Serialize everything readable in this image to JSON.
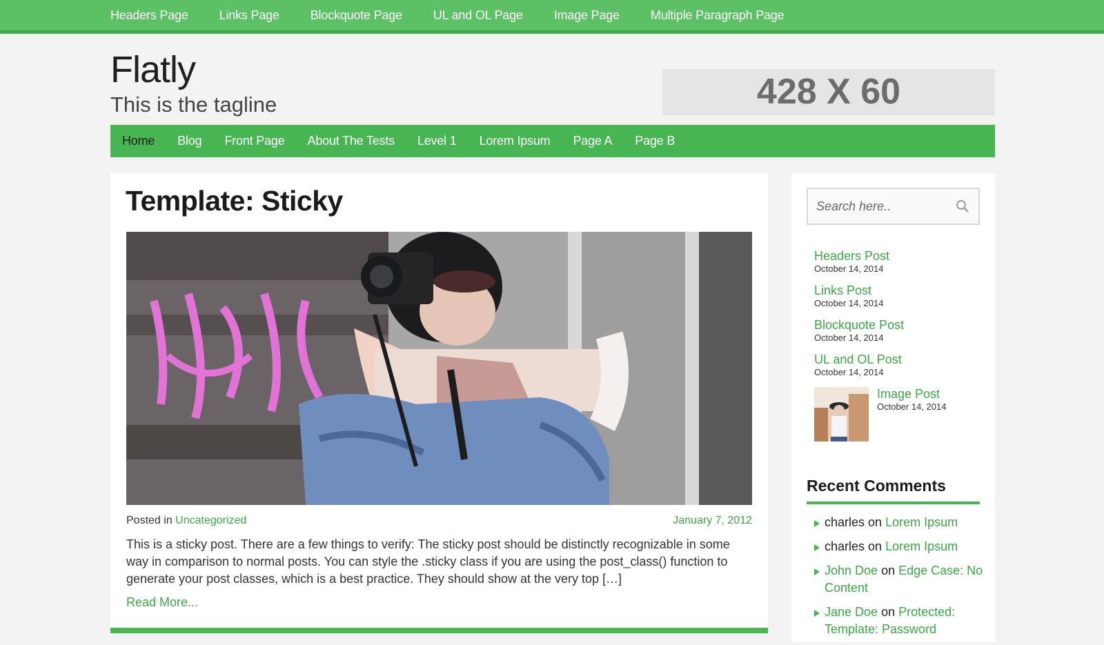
{
  "top_nav": [
    "Headers Page",
    "Links Page",
    "Blockquote Page",
    "UL and OL Page",
    "Image Page",
    "Multiple Paragraph Page"
  ],
  "site": {
    "title": "Flatly",
    "tagline": "This is the tagline",
    "ad_label": "428 X 60"
  },
  "main_nav": [
    "Home",
    "Blog",
    "Front Page",
    "About The Tests",
    "Level 1",
    "Lorem Ipsum",
    "Page A",
    "Page B"
  ],
  "post": {
    "title": "Template: Sticky",
    "posted_in_label": "Posted in",
    "category": "Uncategorized",
    "date": "January 7, 2012",
    "excerpt": "This is a sticky post. There are a few things to verify: The sticky post should be distinctly recognizable in some way in comparison to normal posts. You can style the .sticky class if you are using the post_class() function to generate your post classes, which is a best practice. They should show at the very top […]",
    "read_more": "Read More..."
  },
  "sidebar": {
    "search_placeholder": "Search here..",
    "recent_posts": [
      {
        "title": "Headers Post",
        "date": "October 14, 2014"
      },
      {
        "title": "Links Post",
        "date": "October 14, 2014"
      },
      {
        "title": "Blockquote Post",
        "date": "October 14, 2014"
      },
      {
        "title": "UL and OL Post",
        "date": "October 14, 2014"
      },
      {
        "title": "Image Post",
        "date": "October 14, 2014"
      }
    ],
    "recent_comments_heading": "Recent Comments",
    "recent_comments": [
      {
        "author": "charles",
        "on": "on",
        "post": "Lorem Ipsum"
      },
      {
        "author": "charles",
        "on": "on",
        "post": "Lorem Ipsum"
      },
      {
        "author": "John Doe",
        "on": "on",
        "post": "Edge Case: No Content"
      },
      {
        "author": "Jane Doe",
        "on": "on",
        "post": "Protected: Template: Password"
      }
    ]
  },
  "colors": {
    "accent": "#48b553",
    "link": "#3aa845",
    "background": "#f3f3f3"
  }
}
